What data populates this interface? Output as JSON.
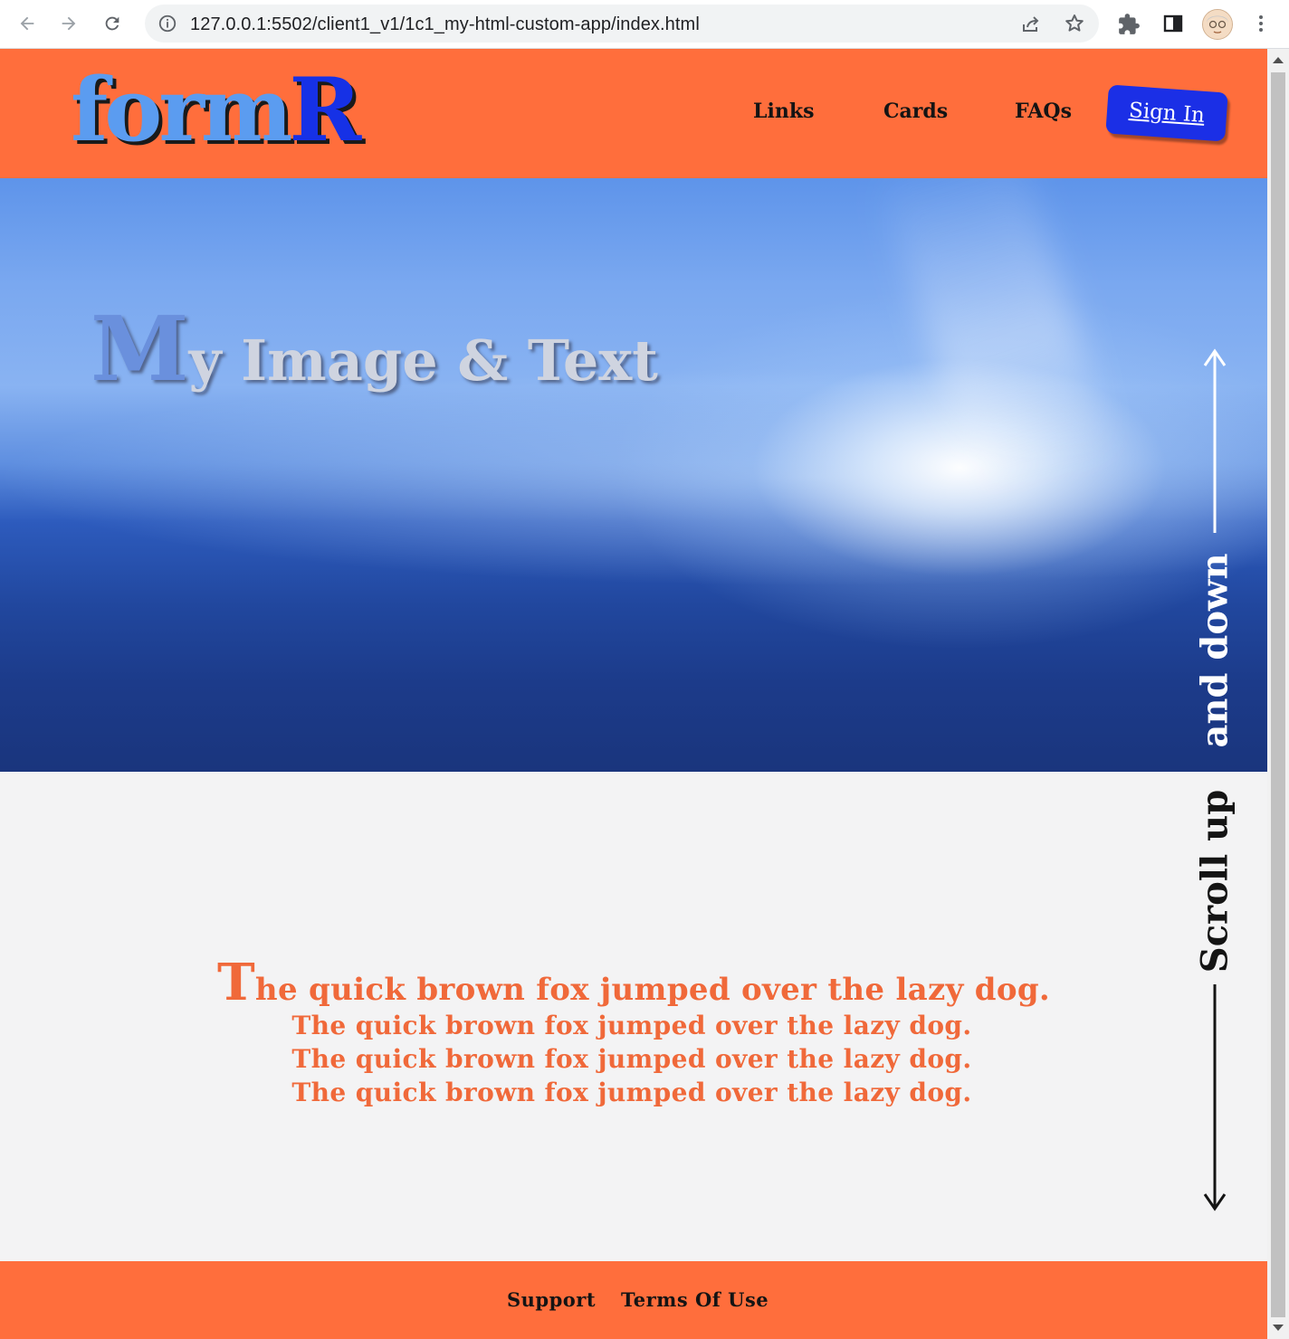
{
  "browser": {
    "url": "127.0.0.1:5502/client1_v1/1c1_my-html-custom-app/index.html"
  },
  "header": {
    "logo_main": "form",
    "logo_accent": "R",
    "nav": [
      {
        "label": "Links"
      },
      {
        "label": "Cards"
      },
      {
        "label": "FAQs"
      }
    ],
    "sign_in": "Sign In"
  },
  "hero": {
    "title_cap": "M",
    "title_rest": "y Image & Text"
  },
  "content": {
    "headline_cap": "T",
    "headline_rest": "he quick brown fox jumped over the lazy dog.",
    "lines": [
      "The quick brown fox jumped over the lazy dog.",
      "The quick brown fox jumped over the lazy dog.",
      "The quick brown fox jumped over the lazy dog."
    ]
  },
  "scroll_hint": {
    "part1": "and down",
    "part2": "Scroll up"
  },
  "footer": {
    "links": [
      {
        "label": "Support"
      },
      {
        "label": "Terms Of Use"
      }
    ]
  },
  "colors": {
    "brand_orange": "#ff6e3c",
    "text_orange": "#f0693a",
    "sign_in_blue": "#1b2fe6",
    "logo_light_blue": "#5b9cf0"
  }
}
